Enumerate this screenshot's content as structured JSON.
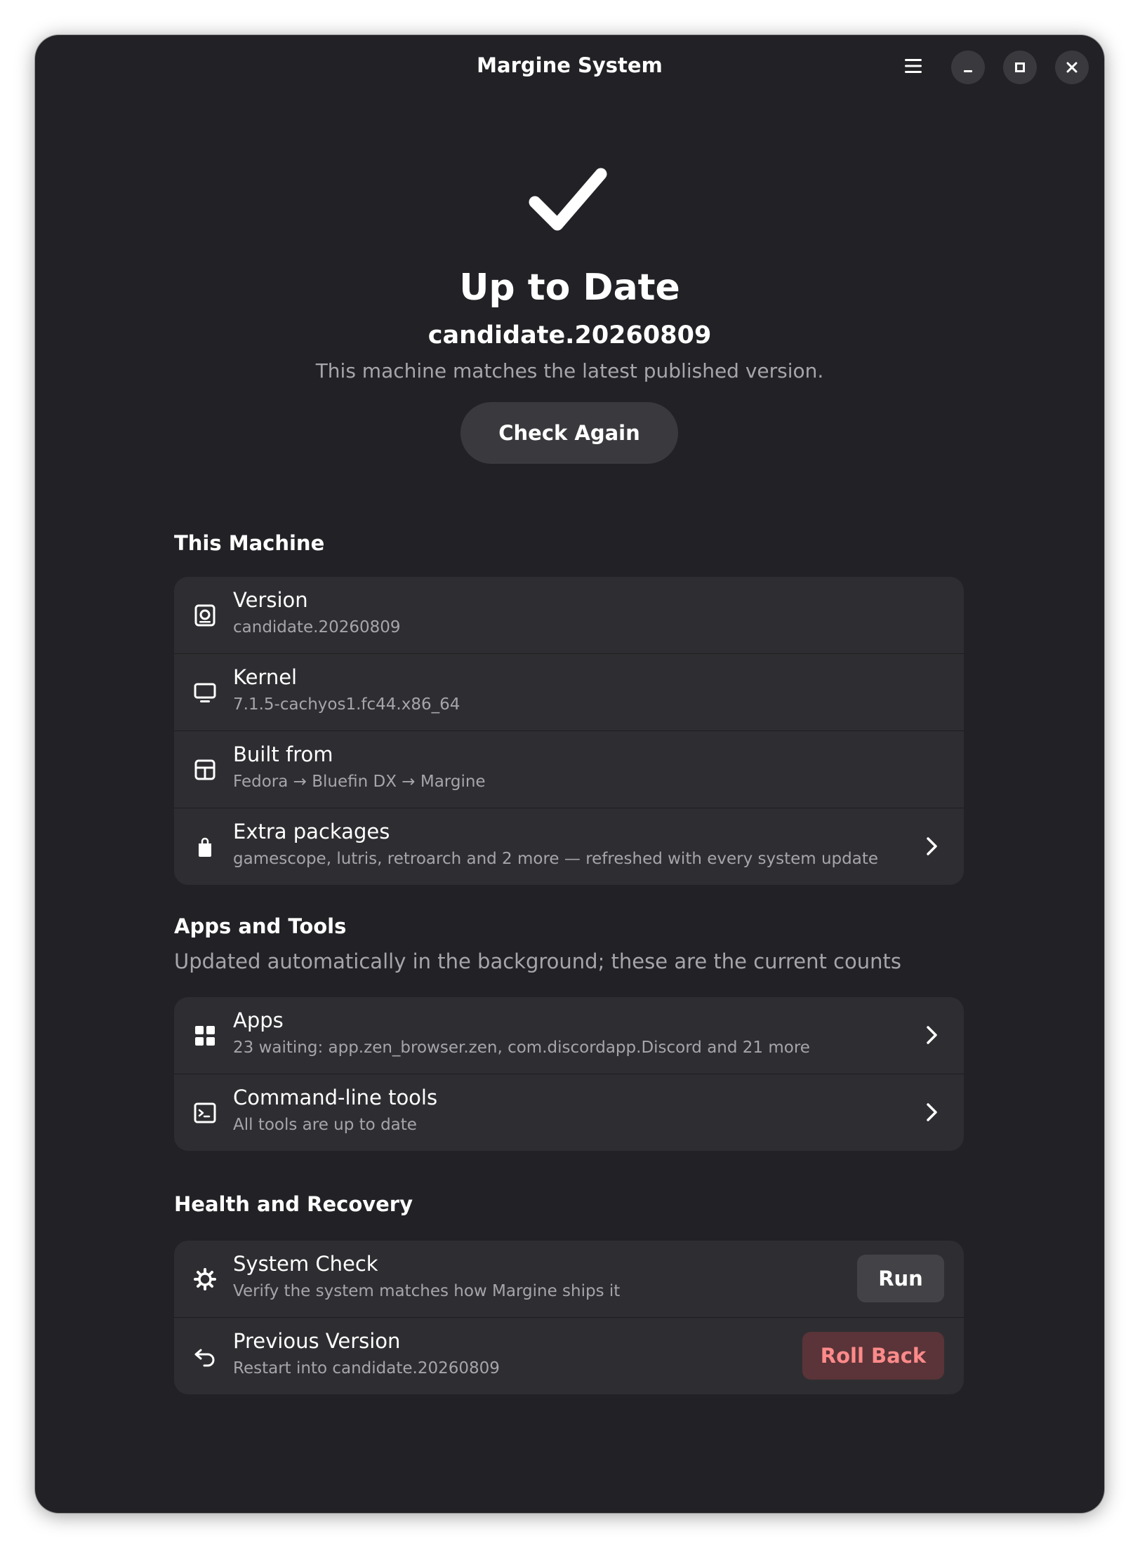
{
  "window": {
    "title": "Margine System"
  },
  "header": {
    "icons": [
      "hamburger-menu-icon",
      "minimize-icon",
      "maximize-icon",
      "close-icon"
    ]
  },
  "status": {
    "icon": "checkmark-icon",
    "title": "Up to Date",
    "version": "candidate.20260809",
    "description": "This machine matches the latest published version.",
    "check_again_label": "Check Again"
  },
  "this_machine": {
    "title": "This Machine",
    "rows": [
      {
        "icon": "disk-icon",
        "title": "Version",
        "subtitle": "candidate.20260809"
      },
      {
        "icon": "monitor-icon",
        "title": "Kernel",
        "subtitle": "7.1.5-cachyos1.fc44.x86_64"
      },
      {
        "icon": "package-box-icon",
        "title": "Built from",
        "subtitle": "Fedora → Bluefin DX → Margine"
      },
      {
        "icon": "shopping-bag-icon",
        "title": "Extra packages",
        "subtitle": "gamescope, lutris, retroarch and 2 more — refreshed with every system update"
      }
    ]
  },
  "apps_and_tools": {
    "title": "Apps and Tools",
    "subtitle": "Updated automatically in the background; these are the current counts",
    "rows": [
      {
        "icon": "app-grid-icon",
        "title": "Apps",
        "subtitle": "23 waiting: app.zen_browser.zen, com.discordapp.Discord and 21 more"
      },
      {
        "icon": "terminal-icon",
        "title": "Command-line tools",
        "subtitle": "All tools are up to date"
      }
    ]
  },
  "health_and_recovery": {
    "title": "Health and Recovery",
    "rows": [
      {
        "icon": "gear-icon",
        "title": "System Check",
        "subtitle": "Verify the system matches how Margine ships it",
        "action_label": "Run"
      },
      {
        "icon": "undo-arrow-icon",
        "title": "Previous Version",
        "subtitle": "Restart into candidate.20260809",
        "action_label": "Roll Back"
      }
    ]
  },
  "colors": {
    "window_bg": "#222226",
    "card_bg": "#2e2e32",
    "button_bg": "#3a3a3e",
    "destructive_bg": "#5a3438",
    "destructive_text": "#ff8a8a",
    "dim_text": "#a6a6aa"
  }
}
